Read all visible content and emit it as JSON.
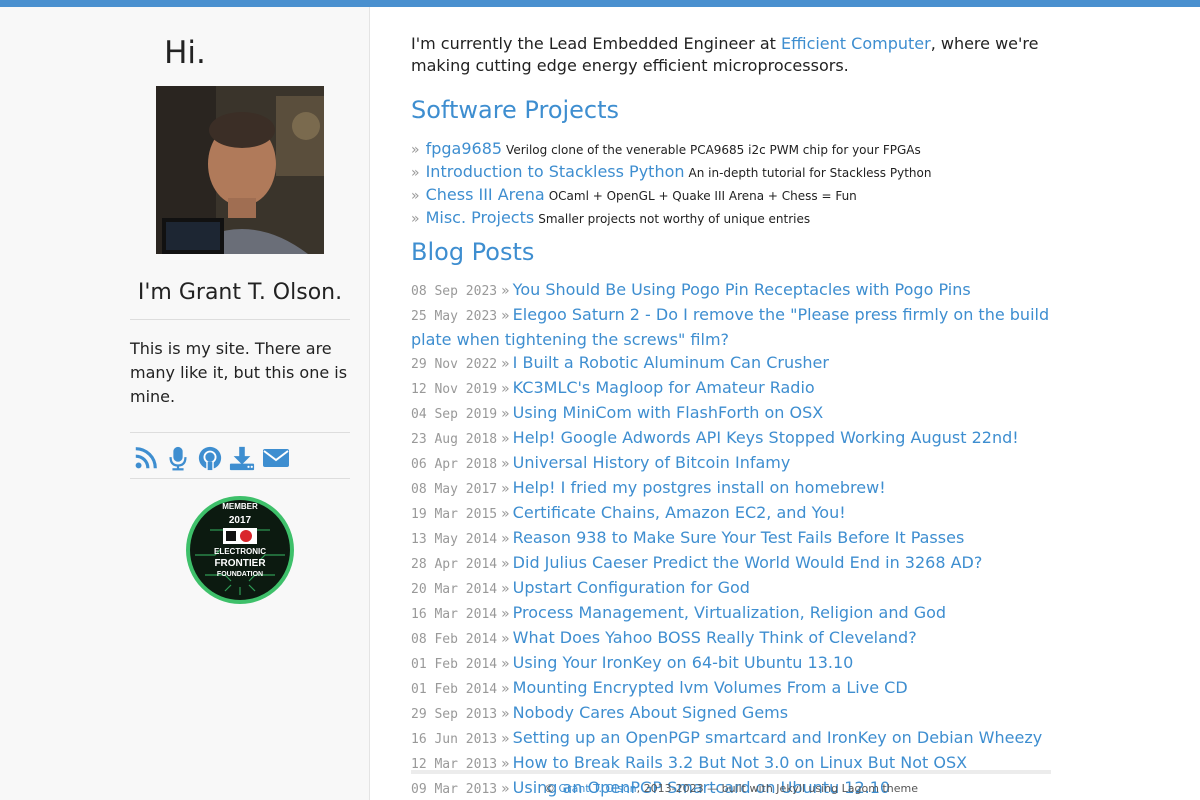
{
  "sidebar": {
    "greeting": "Hi.",
    "name": "I'm Grant T. Olson.",
    "tagline": "This is my site. There are many like it, but this one is mine.",
    "social_icons": [
      "rss-icon",
      "microphone-icon",
      "github-icon",
      "download-icon",
      "envelope-icon"
    ],
    "eff_badge": {
      "year": "2017"
    }
  },
  "intro": {
    "before": "I'm currently the Lead Embedded Engineer at ",
    "link": "Efficient Computer",
    "after": ", where we're making cutting edge energy efficient microprocessors."
  },
  "software_heading": "Software Projects",
  "projects": [
    {
      "title": "fpga9685",
      "desc": "Verilog clone of the venerable PCA9685 i2c PWM chip for your FPGAs"
    },
    {
      "title": "Introduction to Stackless Python",
      "desc": "An in-depth tutorial for Stackless Python"
    },
    {
      "title": "Chess III Arena",
      "desc": "OCaml + OpenGL + Quake III Arena + Chess = Fun"
    },
    {
      "title": "Misc. Projects",
      "desc": "Smaller projects not worthy of unique entries"
    }
  ],
  "blog_heading": "Blog Posts",
  "posts": [
    {
      "date": "08 Sep 2023",
      "title": "You Should Be Using Pogo Pin Receptacles with Pogo Pins"
    },
    {
      "date": "25 May 2023",
      "title": "Elegoo Saturn 2 - Do I remove the \"Please press firmly on the build plate when tightening the screws\" film?"
    },
    {
      "date": "29 Nov 2022",
      "title": "I Built a Robotic Aluminum Can Crusher"
    },
    {
      "date": "12 Nov 2019",
      "title": "KC3MLC's Magloop for Amateur Radio"
    },
    {
      "date": "04 Sep 2019",
      "title": "Using MiniCom with FlashForth on OSX"
    },
    {
      "date": "23 Aug 2018",
      "title": "Help! Google Adwords API Keys Stopped Working August 22nd!"
    },
    {
      "date": "06 Apr 2018",
      "title": "Universal History of Bitcoin Infamy"
    },
    {
      "date": "08 May 2017",
      "title": "Help! I fried my postgres install on homebrew!"
    },
    {
      "date": "19 Mar 2015",
      "title": "Certificate Chains, Amazon EC2, and You!"
    },
    {
      "date": "13 May 2014",
      "title": "Reason 938 to Make Sure Your Test Fails Before It Passes"
    },
    {
      "date": "28 Apr 2014",
      "title": "Did Julius Caeser Predict the World Would End in 3268 AD?"
    },
    {
      "date": "20 Mar 2014",
      "title": "Upstart Configuration for God"
    },
    {
      "date": "16 Mar 2014",
      "title": "Process Management, Virtualization, Religion and God"
    },
    {
      "date": "08 Feb 2014",
      "title": "What Does Yahoo BOSS Really Think of Cleveland?"
    },
    {
      "date": "01 Feb 2014",
      "title": "Using Your IronKey on 64-bit Ubuntu 13.10"
    },
    {
      "date": "01 Feb 2014",
      "title": "Mounting Encrypted lvm Volumes From a Live CD"
    },
    {
      "date": "29 Sep 2013",
      "title": "Nobody Cares About Signed Gems"
    },
    {
      "date": "16 Jun 2013",
      "title": "Setting up an OpenPGP smartcard and IronKey on Debian Wheezy"
    },
    {
      "date": "12 Mar 2013",
      "title": "How to Break Rails 3.2 But Not 3.0 on Linux But Not OSX"
    },
    {
      "date": "09 Mar 2013",
      "title": "Using an OpenPGP Smartcard on Ubuntu 12.10"
    }
  ],
  "footer": {
    "prefix": "© ",
    "author": "Grant T. Olson",
    "suffix": ", 2013-2023 — built with Jekyll using Lagom theme"
  },
  "colors": {
    "accent": "#3e8ed0",
    "topbar": "#4a90cf",
    "muted": "#999999"
  }
}
